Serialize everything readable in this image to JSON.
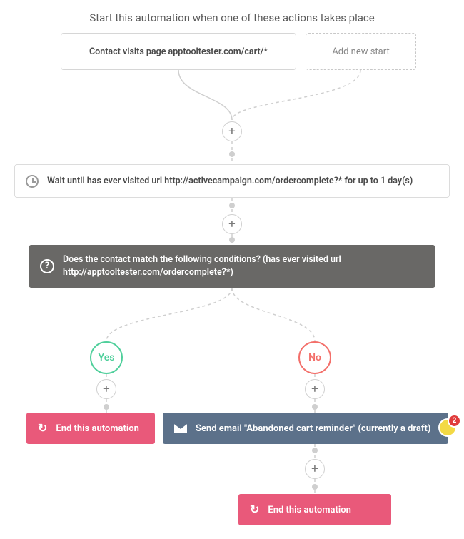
{
  "header": {
    "title": "Start this automation when one of these actions takes place"
  },
  "start_trigger": {
    "label": "Contact visits page apptooltester.com/cart/*"
  },
  "add_start": {
    "label": "Add new start"
  },
  "wait": {
    "text": "Wait until has ever visited url http://activecampaign.com/ordercomplete?* for up to 1 day(s)"
  },
  "condition": {
    "text": "Does the contact match the following conditions? (has ever visited url http://apptooltester.com/ordercomplete?*)"
  },
  "yes": {
    "label": "Yes"
  },
  "no": {
    "label": "No"
  },
  "end_yes": {
    "label": "End this automation"
  },
  "send_email": {
    "label": "Send email \"Abandoned cart reminder\" (currently a draft)"
  },
  "end_no": {
    "label": "End this automation"
  },
  "note": {
    "count": "2"
  },
  "colors": {
    "pink": "#e9597a",
    "slate": "#5c718a",
    "condition_bg": "#696866",
    "yes": "#4fcf9b",
    "no": "#f36f6a",
    "connector": "#cfcfcf"
  }
}
